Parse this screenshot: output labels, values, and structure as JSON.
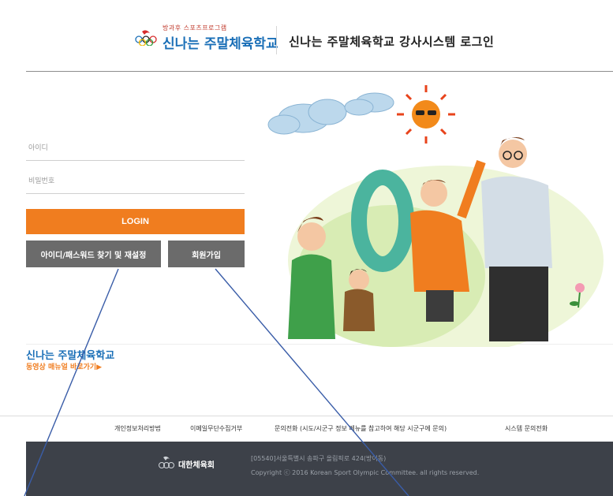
{
  "header": {
    "logo_small": "방과후 스포츠프로그램",
    "logo_main": "신나는 주말체육학교",
    "system_title": "신나는 주말체육학교 강사시스템 로그인"
  },
  "login_form": {
    "id_placeholder": "아이디",
    "pw_placeholder": "비밀번호",
    "login_label": "LOGIN",
    "find_label": "아이디/패스워드 찾기 및 재설정",
    "join_label": "회원가입"
  },
  "promo": {
    "title": "신나는 주말체육학교",
    "link": "동영상 매뉴얼 바로가기▶"
  },
  "footer": {
    "links": [
      "개인정보처리방법",
      "이메일무단수집거부",
      "문의전화 (시도/시군구 정보 메뉴를 참고하여 해당 시군구에 문의)",
      "시스템 문의전화"
    ],
    "org_name": "대한체육회",
    "address": "[05540]서울특별시 송파구 올림픽로 424(방이동)",
    "copyright": "Copyright ⓒ 2016 Korean Sport Olympic Committee. all rights reserved."
  },
  "colors": {
    "brand_blue": "#1a6fb7",
    "accent_orange": "#f07d1f",
    "button_gray": "#6b6b6b",
    "footer_dark": "#3d4149"
  }
}
